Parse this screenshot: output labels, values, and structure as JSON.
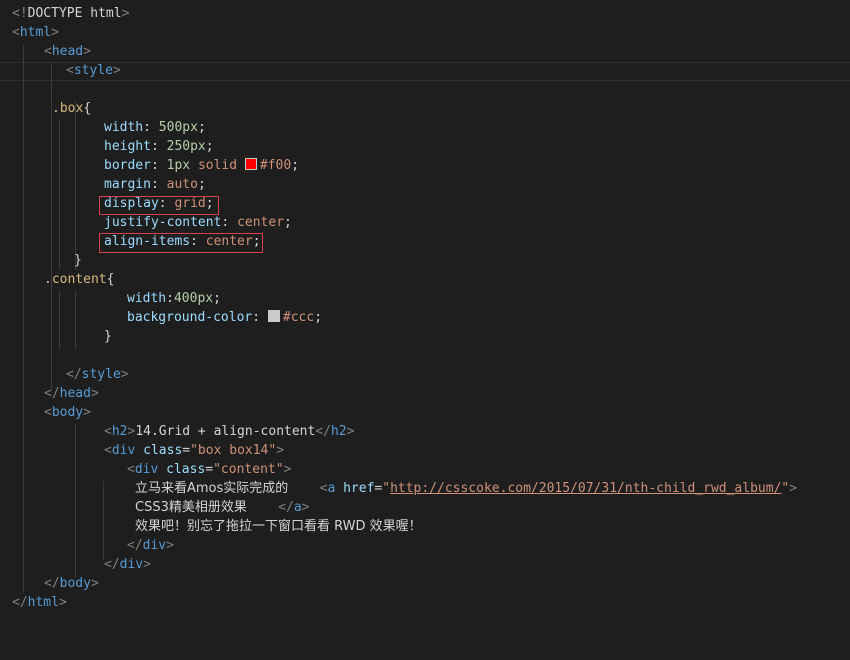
{
  "editor": {
    "language": "html",
    "lines": [
      {
        "tokens": [
          [
            "gray",
            "<!"
          ],
          [
            "text",
            "DOCTYPE html"
          ],
          [
            "gray",
            ">"
          ]
        ]
      },
      {
        "tokens": [
          [
            "gray",
            "<"
          ],
          [
            "tag",
            "html"
          ],
          [
            "gray",
            ">"
          ]
        ]
      },
      {
        "tokens": [
          [
            "gray",
            "<"
          ],
          [
            "tag",
            "head"
          ],
          [
            "gray",
            ">"
          ]
        ]
      },
      {
        "tokens": [
          [
            "gray",
            "<"
          ],
          [
            "tag",
            "style"
          ],
          [
            "gray",
            ">"
          ]
        ]
      },
      {
        "tokens": []
      },
      {
        "tokens": [
          [
            "sel",
            ".box"
          ],
          [
            "punc",
            "{"
          ]
        ]
      },
      {
        "tokens": [
          [
            "prop",
            "width"
          ],
          [
            "punc",
            ": "
          ],
          [
            "num",
            "500px"
          ],
          [
            "punc",
            ";"
          ]
        ]
      },
      {
        "tokens": [
          [
            "prop",
            "height"
          ],
          [
            "punc",
            ": "
          ],
          [
            "num",
            "250px"
          ],
          [
            "punc",
            ";"
          ]
        ]
      },
      {
        "tokens": [
          [
            "prop",
            "border"
          ],
          [
            "punc",
            ": "
          ],
          [
            "num",
            "1px"
          ],
          [
            "punc",
            " "
          ],
          [
            "val",
            "solid"
          ],
          [
            "punc",
            " "
          ],
          [
            "swatch",
            "#ff0000"
          ],
          [
            "val",
            "#f00"
          ],
          [
            "punc",
            ";"
          ]
        ]
      },
      {
        "tokens": [
          [
            "prop",
            "margin"
          ],
          [
            "punc",
            ": "
          ],
          [
            "val",
            "auto"
          ],
          [
            "punc",
            ";"
          ]
        ]
      },
      {
        "tokens": [
          [
            "prop",
            "display"
          ],
          [
            "punc",
            ": "
          ],
          [
            "val",
            "grid"
          ],
          [
            "punc",
            ";"
          ]
        ]
      },
      {
        "tokens": [
          [
            "prop",
            "justify-content"
          ],
          [
            "punc",
            ": "
          ],
          [
            "val",
            "center"
          ],
          [
            "punc",
            ";"
          ]
        ]
      },
      {
        "tokens": [
          [
            "prop",
            "align-items"
          ],
          [
            "punc",
            ": "
          ],
          [
            "val",
            "center"
          ],
          [
            "punc",
            ";"
          ]
        ]
      },
      {
        "tokens": [
          [
            "punc",
            "}"
          ]
        ]
      },
      {
        "tokens": [
          [
            "sel",
            ".content"
          ],
          [
            "punc",
            "{"
          ]
        ]
      },
      {
        "tokens": [
          [
            "prop",
            "width"
          ],
          [
            "punc",
            ":"
          ],
          [
            "num",
            "400px"
          ],
          [
            "punc",
            ";"
          ]
        ]
      },
      {
        "tokens": [
          [
            "prop",
            "background-color"
          ],
          [
            "punc",
            ": "
          ],
          [
            "swatch",
            "#cccccc"
          ],
          [
            "val",
            "#ccc"
          ],
          [
            "punc",
            ";"
          ]
        ]
      },
      {
        "tokens": [
          [
            "punc",
            "}"
          ]
        ]
      },
      {
        "tokens": []
      },
      {
        "tokens": [
          [
            "gray",
            "</"
          ],
          [
            "tag",
            "style"
          ],
          [
            "gray",
            ">"
          ]
        ]
      },
      {
        "tokens": [
          [
            "gray",
            "</"
          ],
          [
            "tag",
            "head"
          ],
          [
            "gray",
            ">"
          ]
        ]
      },
      {
        "tokens": [
          [
            "gray",
            "<"
          ],
          [
            "tag",
            "body"
          ],
          [
            "gray",
            ">"
          ]
        ]
      },
      {
        "tokens": [
          [
            "gray",
            "<"
          ],
          [
            "tag",
            "h2"
          ],
          [
            "gray",
            ">"
          ],
          [
            "text",
            "14.Grid + align-content"
          ],
          [
            "gray",
            "</"
          ],
          [
            "tag",
            "h2"
          ],
          [
            "gray",
            ">"
          ]
        ]
      },
      {
        "tokens": [
          [
            "gray",
            "<"
          ],
          [
            "tag",
            "div"
          ],
          [
            "punc",
            " "
          ],
          [
            "attr",
            "class"
          ],
          [
            "punc",
            "="
          ],
          [
            "str",
            "\"box box14\""
          ],
          [
            "gray",
            ">"
          ]
        ]
      },
      {
        "tokens": [
          [
            "gray",
            "<"
          ],
          [
            "tag",
            "div"
          ],
          [
            "punc",
            " "
          ],
          [
            "attr",
            "class"
          ],
          [
            "punc",
            "="
          ],
          [
            "str",
            "\"content\""
          ],
          [
            "gray",
            ">"
          ]
        ]
      },
      {
        "tokens": [
          [
            "cjk",
            "立马来看Amos实际完成的"
          ],
          [
            "punc",
            "    "
          ],
          [
            "gray",
            "<"
          ],
          [
            "tag",
            "a"
          ],
          [
            "punc",
            " "
          ],
          [
            "attr",
            "href"
          ],
          [
            "punc",
            "="
          ],
          [
            "str",
            "\""
          ],
          [
            "url",
            "http://csscoke.com/2015/07/31/nth-child_rwd_album/"
          ],
          [
            "str",
            "\""
          ],
          [
            "gray",
            ">"
          ]
        ]
      },
      {
        "tokens": [
          [
            "cjk",
            "CSS3精美相册效果"
          ],
          [
            "punc",
            "    "
          ],
          [
            "gray",
            "</"
          ],
          [
            "tag",
            "a"
          ],
          [
            "gray",
            ">"
          ]
        ]
      },
      {
        "tokens": [
          [
            "cjk",
            "效果吧！别忘了拖拉一下窗口看看 RWD 效果喔！"
          ]
        ]
      },
      {
        "tokens": [
          [
            "gray",
            "</"
          ],
          [
            "tag",
            "div"
          ],
          [
            "gray",
            ">"
          ]
        ]
      },
      {
        "tokens": [
          [
            "gray",
            "</"
          ],
          [
            "tag",
            "div"
          ],
          [
            "gray",
            ">"
          ]
        ]
      },
      {
        "tokens": [
          [
            "gray",
            "</"
          ],
          [
            "tag",
            "body"
          ],
          [
            "gray",
            ">"
          ]
        ]
      },
      {
        "tokens": [
          [
            "gray",
            "</"
          ],
          [
            "tag",
            "html"
          ],
          [
            "gray",
            ">"
          ]
        ]
      }
    ]
  }
}
